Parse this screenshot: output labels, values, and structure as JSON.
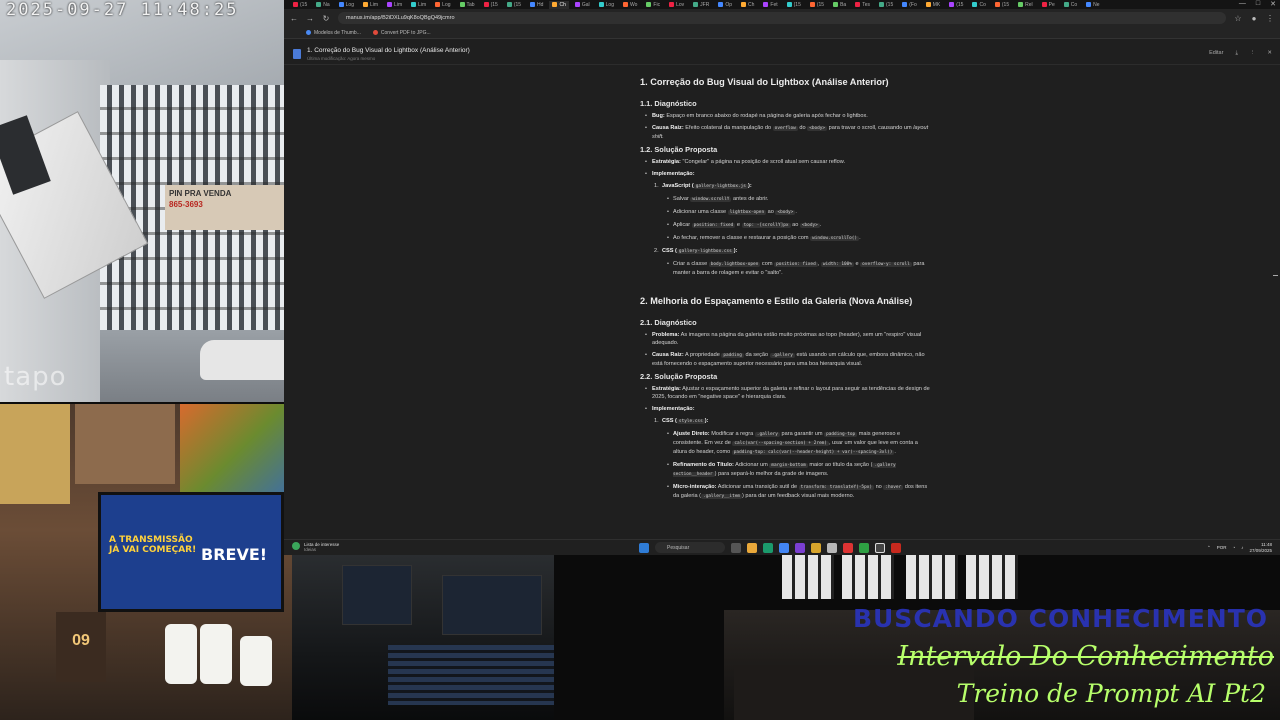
{
  "camera": {
    "timestamp": "2025-09-27 11:48:25",
    "brand": "tapo"
  },
  "overlay": {
    "line1": "BUSCANDO CONHECIMENTO",
    "line2": "Intervalo Do Conhecimento",
    "line3": "Treino de Prompt AI Pt2"
  },
  "desk_monitor": {
    "text1": "A TRANSMISSÃO JÁ VAI COMEÇAR!",
    "text2": "BREVE!"
  },
  "desk_calendar": "09",
  "gate_sign": {
    "line1": "PIN  PRA  VENDA",
    "line2": "865-3693"
  },
  "browser": {
    "url": "manus.im/app/B2iDXLu9qK8oQBgQ49jcmro",
    "bookmarks": [
      "Modelos de Thumb...",
      "Convert PDF to JPG..."
    ],
    "tabs": [
      "(15",
      "Na",
      "Log",
      "Lim",
      "Lim",
      "Lim",
      "Log",
      "Tab",
      "(15",
      "(15",
      "Hd",
      "Ch",
      "Gal",
      "Log",
      "Wo",
      "Fic",
      "Lov",
      "JFR",
      "Op",
      "Ch",
      "Fet",
      "(15",
      "(15",
      "Ba",
      "Tes",
      "(15",
      "(Fo",
      "MK",
      "(15",
      "Co",
      "(15",
      "Rel",
      "Pe",
      "Co",
      "Ne"
    ]
  },
  "doc": {
    "title": "1. Correção do Bug Visual do Lightbox (Análise Anterior)",
    "subtitle": "Última modificação: Agora mesmo",
    "actions": [
      "Editar",
      "⤓",
      "⋮",
      "✕"
    ]
  },
  "content": {
    "s1_title": "1. Correção do Bug Visual do Lightbox (Análise Anterior)",
    "s1_1": "1.1. Diagnóstico",
    "bug_label": "Bug:",
    "bug_text": "Espaço em branco abaixo do rodapé na página de galeria após fechar o lightbox.",
    "cause_label": "Causa Raiz:",
    "cause_text_a": "Efeito colateral da manipulação do",
    "cause_code1": "overflow",
    "cause_text_b": "do",
    "cause_code2": "<body>",
    "cause_text_c": "para travar o scroll, causando um",
    "cause_text_d": "layout shift.",
    "s1_2": "1.2. Solução Proposta",
    "strat_label": "Estratégia:",
    "strat_text": "\"Congelar\" a página na posição de scroll atual sem causar reflow.",
    "impl_label": "Implementação:",
    "js_label": "JavaScript (",
    "js_code": "gallery-lightbox.js",
    "js_end": "):",
    "js1_a": "Salvar",
    "js1_code": "window.scrollY",
    "js1_b": "antes de abrir.",
    "js2_a": "Adicionar uma classe",
    "js2_code": "lightbox-open",
    "js2_b": "ao",
    "js2_code2": "<body>",
    "js2_c": ".",
    "js3_a": "Aplicar",
    "js3_code": "position: fixed",
    "js3_b": "e",
    "js3_code2": "top: -[scrollY]px",
    "js3_c": "ao",
    "js3_code3": "<body>",
    "js3_d": ".",
    "js4_a": "Ao fechar, remover a classe e restaurar a posição com",
    "js4_code": "window.scrollTo()",
    "js4_b": ".",
    "css_label": "CSS (",
    "css_code": "gallery-lightbox.css",
    "css_end": "):",
    "css1_a": "Criar a classe",
    "css1_code": "body.lightbox-open",
    "css1_b": "com",
    "css1_code2": "position: fixed",
    "css1_code3": "width: 100%",
    "css1_c": "e",
    "css1_code4": "overflow-y: scroll",
    "css1_d": "para manter a barra de rolagem e evitar o \"salto\".",
    "s2_title": "2. Melhoria do Espaçamento e Estilo da Galeria (Nova Análise)",
    "s2_1": "2.1. Diagnóstico",
    "prob_label": "Problema:",
    "prob_text": "As imagens na página da galeria estão muito próximas ao topo (header), sem um \"respiro\" visual adequado.",
    "cause2_label": "Causa Raiz:",
    "cause2_a": "A propriedade",
    "cause2_code1": "padding",
    "cause2_b": "da seção",
    "cause2_code2": ".gallery",
    "cause2_c": "está usando um cálculo que, embora dinâmico, não está fornecendo o espaçamento superior necessário para uma boa hierarquia visual.",
    "s2_2": "2.2. Solução Proposta",
    "strat2_label": "Estratégia:",
    "strat2_text": "Ajustar o espaçamento superior da galeria e refinar o layout para seguir as tendências de design de 2025, focando em \"negative space\" e hierarquia clara.",
    "impl2_label": "Implementação:",
    "css2_label": "CSS (",
    "css2_code": "style.css",
    "css2_end": "):",
    "adj_label": "Ajuste Direto:",
    "adj_a": "Modificar a regra",
    "adj_code1": ".gallery",
    "adj_b": "para garantir um",
    "adj_code2": "padding-top",
    "adj_c": "mais generoso e consistente. Em vez de",
    "adj_code3": "calc(var(--spacing-section) + 2rem)",
    "adj_d": ", usar um valor que leve em conta a altura do header, como",
    "adj_code4": "padding-top: calc(var(--header-height) + var(--spacing-3xl))",
    "adj_e": ".",
    "ref_label": "Refinamento do Título:",
    "ref_a": "Adicionar um",
    "ref_code1": "margin-bottom",
    "ref_b": "maior ao título da seção (",
    "ref_code2": ".gallery section__header",
    "ref_c": ") para separá-lo melhor da grade de imagens.",
    "micro_label": "Micro-interação:",
    "micro_a": "Adicionar uma transição sutil de",
    "micro_code1": "transform: translateY(-5px)",
    "micro_b": "no",
    "micro_code2": ":hover",
    "micro_c": "dos itens da galeria (",
    "micro_code3": ".gallery__item",
    "micro_d": ") para dar um feedback visual mais moderno."
  },
  "taskbar": {
    "widget_title": "Lista de interesse",
    "widget_sub": "Ideias",
    "search_placeholder": "Pesquisar",
    "lang": "POR",
    "time": "11:48",
    "date": "27/09/2025"
  }
}
